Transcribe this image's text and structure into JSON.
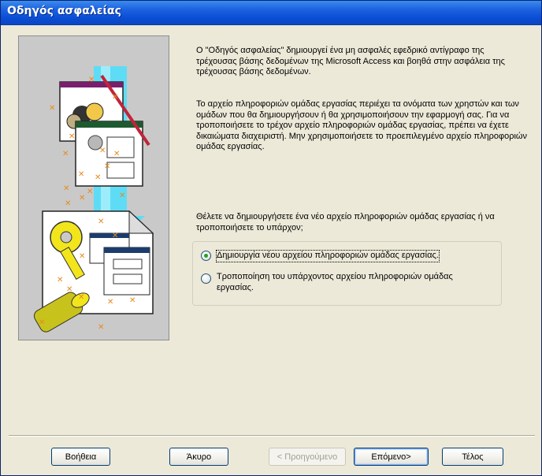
{
  "window": {
    "title": "Οδηγός ασφαλείας"
  },
  "content": {
    "para1": "Ο \"Οδηγός ασφαλείας\" δημιουργεί ένα μη ασφαλές εφεδρικό αντίγραφο της τρέχουσας βάσης δεδομένων της Microsoft Access και βοηθά στην ασφάλεια της τρέχουσας βάσης δεδομένων.",
    "para2": "Το αρχείο πληροφοριών ομάδας εργασίας περιέχει τα ονόματα των χρηστών και των ομάδων που θα δημιουργήσουν ή θα χρησιμοποιήσουν την εφαρμογή σας. Για να τροποποιήσετε το τρέχον αρχείο πληροφοριών ομάδας εργασίας, πρέπει να έχετε δικαιώματα διαχειριστή. Μην χρησιμοποιήσετε το προεπιλεγμένο αρχείο πληροφοριών ομάδας εργασίας.",
    "question": "Θέλετε να δημιουργήσετε ένα νέο αρχείο πληροφοριών ομάδας εργασίας ή να τροποποιήσετε το υπάρχον;"
  },
  "options": {
    "create": {
      "label": "Δημιουργία νέου αρχείου πληροφοριών ομάδας εργασίας.",
      "selected": true
    },
    "modify": {
      "label": "Τροποποίηση του υπάρχοντος αρχείου πληροφοριών ομάδας εργασίας.",
      "selected": false
    }
  },
  "buttons": {
    "help": "Βοήθεια",
    "cancel": "Άκυρο",
    "back": "< Προηγούμενο",
    "next": "Επόμενο>",
    "finish": "Τέλος"
  },
  "colors": {
    "title_bar": "#0a4fd6",
    "face": "#ece9d8",
    "arrow": "#2fd3f5",
    "key": "#f2e51c"
  }
}
